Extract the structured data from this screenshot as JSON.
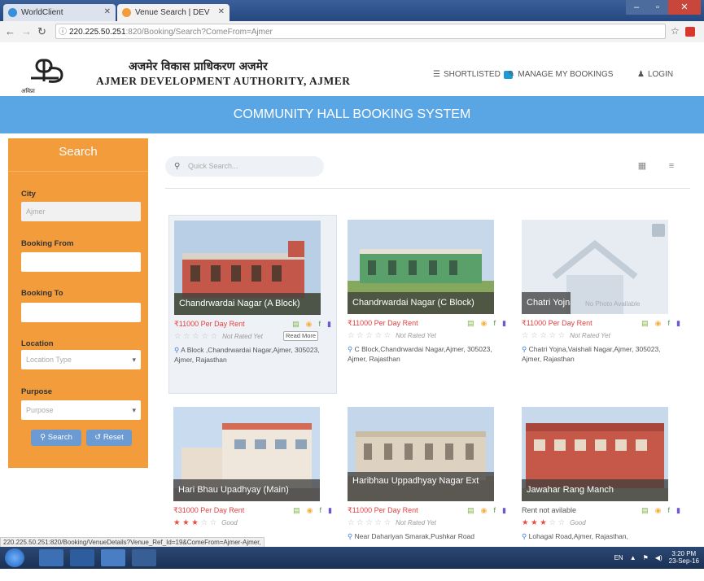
{
  "browser": {
    "tabs": [
      {
        "label": "WorldClient",
        "active": false
      },
      {
        "label": "Venue Search | DEV",
        "active": true
      }
    ],
    "url_host": "220.225.50.251",
    "url_rest": ":820/Booking/Search?ComeFrom=Ajmer"
  },
  "header": {
    "logo_text": "अविप्रा",
    "brand_hindi": "अजमेर विकास प्राधिकरण अजमेर",
    "brand_english": "AJMER DEVELOPMENT AUTHORITY, AJMER",
    "nav": {
      "shortlisted": "SHORTLISTED",
      "manage": "MANAGE MY BOOKINGS",
      "login": "LOGIN"
    }
  },
  "banner": {
    "title": "COMMUNITY HALL BOOKING SYSTEM"
  },
  "sidebar": {
    "title": "Search",
    "city_label": "City",
    "city_value": "Ajmer",
    "from_label": "Booking From",
    "to_label": "Booking To",
    "location_label": "Location",
    "location_value": "Location Type",
    "purpose_label": "Purpose",
    "purpose_value": "Purpose",
    "search_btn": "Search",
    "reset_btn": "Reset"
  },
  "content": {
    "quick_search_placeholder": "Quick Search...",
    "read_more": "Read More",
    "no_photo": "No Photo Available"
  },
  "venues": [
    {
      "name": "Chandrwardai Nagar (A Block)",
      "rent": "₹11000 Per Day Rent",
      "stars": 0,
      "rating": "Not Rated Yet",
      "address": "A Block ,Chandrwardai Nagar,Ajmer, 305023, Ajmer, Rajasthan"
    },
    {
      "name": "Chandrwardai Nagar (C Block)",
      "rent": "₹11000 Per Day Rent",
      "stars": 0,
      "rating": "Not Rated Yet",
      "address": "C Block,Chandrwardai Nagar,Ajmer, 305023, Ajmer, Rajasthan"
    },
    {
      "name": "Chatri Yojna",
      "rent": "₹11000 Per Day Rent",
      "stars": 0,
      "rating": "Not Rated Yet",
      "address": "Chatri Yojna,Vaishali Nagar,Ajmer, 305023, Ajmer, Rajasthan"
    },
    {
      "name": "Hari Bhau Upadhyay (Main)",
      "rent": "₹31000 Per Day Rent",
      "stars": 3,
      "rating": "Good",
      "address": ""
    },
    {
      "name": "Haribhau Uppadhyay Nagar Ext",
      "rent": "₹11000 Per Day Rent",
      "stars": 0,
      "rating": "Not Rated Yet",
      "address": "Near Dahariyan Smarak,Pushkar Road"
    },
    {
      "name": "Jawahar Rang Manch",
      "rent": "Rent not avilable",
      "stars": 3,
      "rating": "Good",
      "address": "Lohagal Road,Ajmer, Rajasthan,"
    }
  ],
  "status_url": "220.225.50.251:820/Booking/VenueDetails?Venue_Ref_Id=19&ComeFrom=Ajmer-Ajmer,",
  "taskbar": {
    "lang": "EN",
    "time": "3:20 PM",
    "date": "23-Sep-16"
  }
}
